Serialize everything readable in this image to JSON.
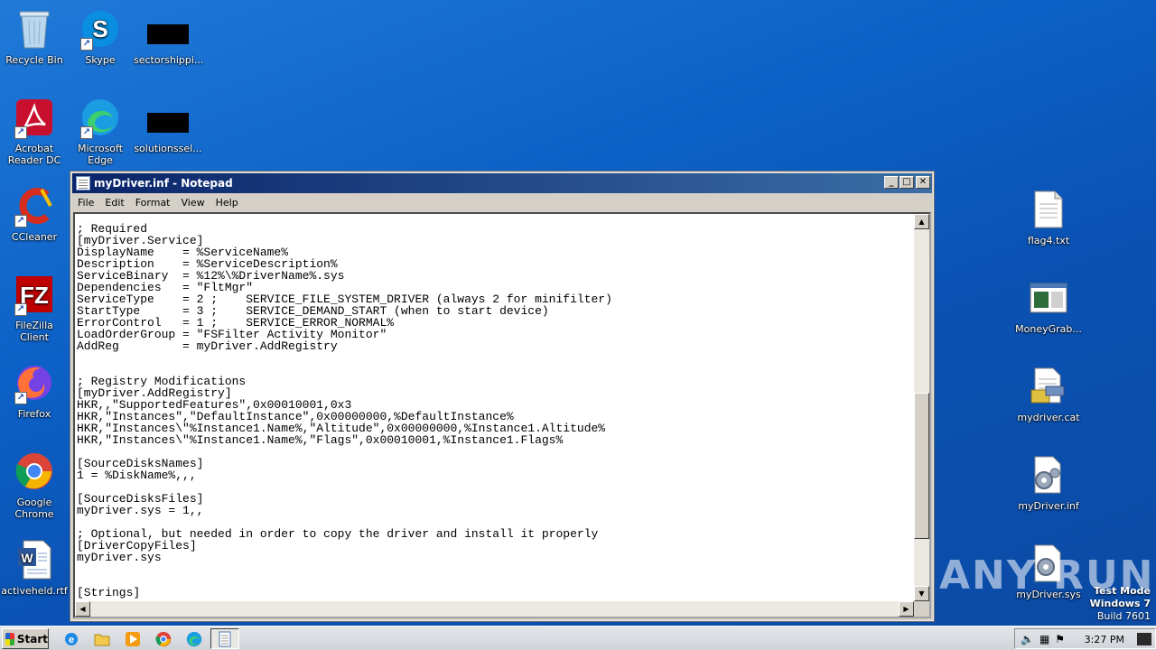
{
  "desktop": {
    "left_icons": [
      {
        "label": "Recycle Bin",
        "icon": "recycle-bin-icon"
      },
      {
        "label": "Skype",
        "icon": "skype-icon"
      },
      {
        "label": "sectorshippi...",
        "icon": "redacted-file-icon"
      },
      {
        "label": "Acrobat Reader DC",
        "icon": "acrobat-icon"
      },
      {
        "label": "Microsoft Edge",
        "icon": "edge-icon"
      },
      {
        "label": "solutionssel...",
        "icon": "redacted-file-icon"
      },
      {
        "label": "CCleaner",
        "icon": "ccleaner-icon"
      },
      {
        "label": "FileZilla Client",
        "icon": "filezilla-icon"
      },
      {
        "label": "Firefox",
        "icon": "firefox-icon"
      },
      {
        "label": "Google Chrome",
        "icon": "chrome-icon"
      },
      {
        "label": "activeheld.rtf",
        "icon": "word-document-icon"
      }
    ],
    "right_icons": [
      {
        "label": "flag4.txt",
        "icon": "text-file-icon"
      },
      {
        "label": "MoneyGrab...",
        "icon": "app-window-icon"
      },
      {
        "label": "mydriver.cat",
        "icon": "security-catalog-icon"
      },
      {
        "label": "myDriver.inf",
        "icon": "setup-info-icon"
      },
      {
        "label": "myDriver.sys",
        "icon": "system-file-icon"
      }
    ]
  },
  "notepad": {
    "title": "myDriver.inf - Notepad",
    "menu": [
      "File",
      "Edit",
      "Format",
      "View",
      "Help"
    ],
    "lines": [
      "; Required",
      "[myDriver.Service]",
      "DisplayName    = %ServiceName%",
      "Description    = %ServiceDescription%",
      "ServiceBinary  = %12%\\%DriverName%.sys",
      "Dependencies   = \"FltMgr\"",
      "ServiceType    = 2 ;    SERVICE_FILE_SYSTEM_DRIVER (always 2 for minifilter)",
      "StartType      = 3 ;    SERVICE_DEMAND_START (when to start device)",
      "ErrorControl   = 1 ;    SERVICE_ERROR_NORMAL%",
      "LoadOrderGroup = \"FSFilter Activity Monitor\"",
      "AddReg         = myDriver.AddRegistry",
      "",
      "",
      "; Registry Modifications",
      "[myDriver.AddRegistry]",
      "HKR,,\"SupportedFeatures\",0x00010001,0x3",
      "HKR,\"Instances\",\"DefaultInstance\",0x00000000,%DefaultInstance%",
      "HKR,\"Instances\\\"%Instance1.Name%,\"Altitude\",0x00000000,%Instance1.Altitude%",
      "HKR,\"Instances\\\"%Instance1.Name%,\"Flags\",0x00010001,%Instance1.Flags%",
      "",
      "[SourceDisksNames]",
      "1 = %DiskName%,,,",
      "",
      "[SourceDisksFiles]",
      "myDriver.sys = 1,,",
      "",
      "; Optional, but needed in order to copy the driver and install it properly",
      "[DriverCopyFiles]",
      "myDriver.sys",
      "",
      "",
      "[Strings]"
    ]
  },
  "watermark": "ANY RUN",
  "test_mode": {
    "line1": "Test Mode",
    "line2": "Windows 7",
    "line3": "Build 7601"
  },
  "taskbar": {
    "start_label": "Start",
    "clock": "3:27 PM"
  }
}
